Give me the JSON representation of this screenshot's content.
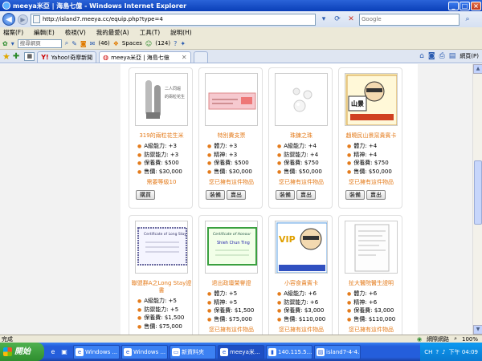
{
  "window": {
    "title": "meeya米亞 | 海島七億 - Windows Internet Explorer",
    "minimize_glyph": "_",
    "maximize_glyph": "□",
    "close_glyph": "×"
  },
  "address": {
    "url": "http://island7.meeya.cc/equip.php?type=4",
    "search_placeholder": "Google"
  },
  "menu": {
    "items": [
      "檔案(F)",
      "編輯(E)",
      "檢視(V)",
      "我的最愛(A)",
      "工具(T)",
      "說明(H)"
    ]
  },
  "toolbar": {
    "search_placeholder": "搜尋網頁",
    "mail_count": "(46)",
    "spaces_label": "Spaces",
    "contacts_count": "(124)"
  },
  "tabs": [
    {
      "label": "Yahoo!奇摩新聞"
    },
    {
      "label": "meeya米亞 | 海島七億"
    }
  ],
  "tab_tools": {
    "page_label": "網頁(P)"
  },
  "cards": [
    {
      "name": "319的兩粒花生米",
      "image": "bullets",
      "stats": [
        "A級能力: +3",
        "防禦能力: +3",
        "保養費: $500",
        "售價: $30,000"
      ],
      "note": "需要等級10",
      "buttons": [
        "購買"
      ]
    },
    {
      "name": "特別費支票",
      "image": "check",
      "stats": [
        "體力: +3",
        "精神: +3",
        "保養費: $500",
        "售價: $30,000"
      ],
      "note": "您已擁有這件物品",
      "buttons": [
        "裝備",
        "賣出"
      ]
    },
    {
      "name": "珠鍊之珠",
      "image": "pearls",
      "stats": [
        "A級能力: +4",
        "防禦能力: +4",
        "保養費: $750",
        "售價: $50,000"
      ],
      "note": "您已擁有這件物品",
      "buttons": [
        "裝備",
        "賣出"
      ]
    },
    {
      "name": "趙曉民山景窯貴賓卡",
      "image": "comic-card",
      "stats": [
        "體力: +4",
        "精神: +4",
        "保養費: $750",
        "售價: $50,000"
      ],
      "note": "您已擁有這件物品",
      "buttons": [
        "裝備",
        "賣出"
      ]
    },
    {
      "name": "聯盟群A之Long Stay證書",
      "image": "certificate",
      "stats": [
        "A級能力: +5",
        "防禦能力: +5",
        "保養費: $1,500",
        "售價: $75,000"
      ],
      "note": "",
      "buttons": []
    },
    {
      "name": "退出政壇榮譽證",
      "image": "certificate-green",
      "stats": [
        "體力: +5",
        "精神: +5",
        "保養費: $1,500",
        "售價: $75,000"
      ],
      "note": "您已擁有這件物品",
      "buttons": []
    },
    {
      "name": "小容食貴賓卡",
      "image": "vip-card",
      "stats": [
        "A級能力: +6",
        "防禦能力: +6",
        "保養費: $3,000",
        "售價: $110,000"
      ],
      "note": "您已擁有這件物品",
      "buttons": []
    },
    {
      "name": "扯大醫院醫生證明",
      "image": "document",
      "stats": [
        "體力: +6",
        "精神: +6",
        "保養費: $3,000",
        "售價: $110,000"
      ],
      "note": "您已擁有這件物品",
      "buttons": []
    }
  ],
  "status": {
    "left": "完成",
    "zone": "網際網路",
    "zoom": "100%"
  },
  "taskbar": {
    "start_label": "開始",
    "items": [
      "Windows ...",
      "Windows ...",
      "新資料夾",
      "meeya米...",
      "140.115.5...",
      "island7-4-4..."
    ],
    "tray_lang": "CH",
    "clock": "下午 04:09"
  }
}
